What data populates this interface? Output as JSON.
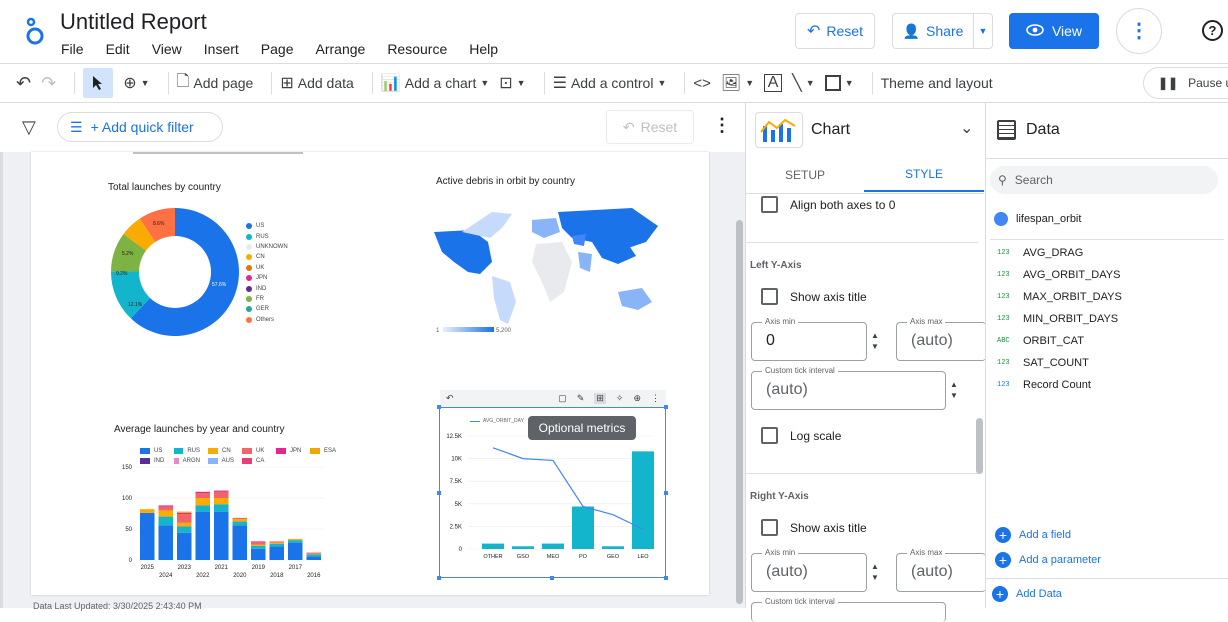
{
  "app": {
    "title": "Untitled Report",
    "menu": [
      "File",
      "Edit",
      "View",
      "Insert",
      "Page",
      "Arrange",
      "Resource",
      "Help"
    ]
  },
  "header": {
    "reset": "Reset",
    "share": "Share",
    "view": "View"
  },
  "toolbar": {
    "add_page": "Add page",
    "add_data": "Add data",
    "add_chart": "Add a chart",
    "add_control": "Add a control",
    "theme": "Theme and layout",
    "pause": "Pause up"
  },
  "filterbar": {
    "quick_filter": "+ Add quick filter",
    "reset": "Reset"
  },
  "canvas": {
    "footer": "Data Last Updated: 3/30/2025 2:43:40 PM",
    "tooltip": "Optional metrics",
    "charts": {
      "donut": {
        "title": "Total launches by country",
        "labels": {
          "us": "57.6%",
          "rus": "12.1%",
          "green": "9.2%",
          "yellow": "5.2%",
          "orange": "8.6%"
        }
      },
      "map": {
        "title": "Active debris in orbit by country",
        "scale_min": "1",
        "scale_max": "5,200"
      },
      "bars": {
        "title": "Average launches by year and country"
      },
      "combo": {
        "legend": "AVG_ORBIT_DAY"
      }
    }
  },
  "chart_data": [
    {
      "type": "pie",
      "title": "Total launches by country",
      "categories": [
        "US",
        "RUS",
        "UNKNOWN",
        "CN",
        "UK",
        "JPN",
        "IND",
        "FR",
        "GER",
        "Others"
      ],
      "values": [
        57.6,
        12.1,
        0,
        5.2,
        0,
        0,
        0,
        9.2,
        0,
        8.6
      ],
      "colors": [
        "#1a73e8",
        "#12b5cb",
        "#e8eaed",
        "#f9ab00",
        "#e8710a",
        "#e52592",
        "#5b2e91",
        "#7cb342",
        "#26a69a",
        "#ff7043"
      ],
      "legend": "right"
    },
    {
      "type": "bar",
      "title": "Average launches by year and country",
      "categories": [
        "2025",
        "2024",
        "2023",
        "2022",
        "2021",
        "2020",
        "2019",
        "2018",
        "2017",
        "2016"
      ],
      "series": [
        {
          "name": "US",
          "values": [
            76,
            56,
            44,
            78,
            78,
            56,
            18,
            22,
            28,
            6
          ]
        },
        {
          "name": "RUS",
          "values": [
            0,
            14,
            10,
            10,
            12,
            6,
            5,
            4,
            4,
            3
          ]
        },
        {
          "name": "CN",
          "values": [
            6,
            10,
            6,
            12,
            10,
            4,
            2,
            2,
            2,
            1
          ]
        },
        {
          "name": "UK",
          "values": [
            0,
            6,
            14,
            8,
            10,
            2,
            4,
            2,
            0,
            2
          ]
        },
        {
          "name": "JPN",
          "values": [
            0,
            2,
            2,
            2,
            2,
            0,
            1,
            0,
            0,
            0
          ]
        },
        {
          "name": "ESA",
          "values": [
            0,
            0,
            2,
            0,
            0,
            0,
            0,
            0,
            0,
            0
          ]
        },
        {
          "name": "IND",
          "values": [
            0,
            0,
            0,
            0,
            0,
            0,
            0,
            0,
            0,
            0
          ]
        },
        {
          "name": "ARGN",
          "values": [
            0,
            0,
            0,
            0,
            0,
            0,
            0,
            0,
            0,
            0
          ]
        },
        {
          "name": "AUS",
          "values": [
            0,
            0,
            0,
            0,
            0,
            0,
            0,
            0,
            0,
            0
          ]
        },
        {
          "name": "CA",
          "values": [
            0,
            0,
            0,
            0,
            0,
            0,
            0,
            0,
            0,
            0
          ]
        }
      ],
      "colors": [
        "#1a73e8",
        "#12b5cb",
        "#f9ab00",
        "#f06666",
        "#e52592",
        "#f2a600",
        "#5b2e91",
        "#e58ac8",
        "#8ab4f8",
        "#e83e78"
      ],
      "yticks": [
        0,
        50,
        100,
        150
      ],
      "ylim": [
        0,
        150
      ]
    },
    {
      "type": "bar",
      "categories": [
        "OTHER",
        "GSO",
        "MEO",
        "PO",
        "GEO",
        "LEO"
      ],
      "bar_values": [
        600,
        300,
        600,
        4700,
        300,
        10800
      ],
      "line_name": "AVG_ORBIT_DAY",
      "line_values": [
        11200,
        10000,
        9800,
        4700,
        3800,
        2200
      ],
      "yticks": [
        "0",
        "2.5K",
        "5K",
        "7.5K",
        "10K",
        "12.5K"
      ],
      "ylim": [
        0,
        12500
      ]
    }
  ],
  "chart_panel": {
    "title": "Chart",
    "tab_setup": "SETUP",
    "tab_style": "STYLE",
    "align_axes": "Align both axes to 0",
    "left_axis": "Left Y-Axis",
    "show_title": "Show axis title",
    "axis_min_label": "Axis min",
    "axis_min_value": "0",
    "axis_max_label": "Axis max",
    "axis_max_value": "(auto)",
    "tick_label": "Custom tick interval",
    "tick_value": "(auto)",
    "log_scale": "Log scale",
    "right_axis": "Right Y-Axis",
    "show_title2": "Show axis title",
    "r_min_label": "Axis min",
    "r_min_value": "(auto)",
    "r_max_label": "Axis max",
    "r_max_value": "(auto)",
    "r_tick_label": "Custom tick interval"
  },
  "data_panel": {
    "title": "Data",
    "search_placeholder": "Search",
    "source": "lifespan_orbit",
    "fields": [
      {
        "type": "123",
        "name": "AVG_DRAG"
      },
      {
        "type": "123",
        "name": "AVG_ORBIT_DAYS"
      },
      {
        "type": "123",
        "name": "MAX_ORBIT_DAYS"
      },
      {
        "type": "123",
        "name": "MIN_ORBIT_DAYS"
      },
      {
        "type": "ABC",
        "name": "ORBIT_CAT"
      },
      {
        "type": "123",
        "name": "SAT_COUNT"
      },
      {
        "type": "123",
        "name": "Record Count"
      }
    ],
    "add_field": "Add a field",
    "add_parameter": "Add a parameter",
    "add_data": "Add Data"
  }
}
